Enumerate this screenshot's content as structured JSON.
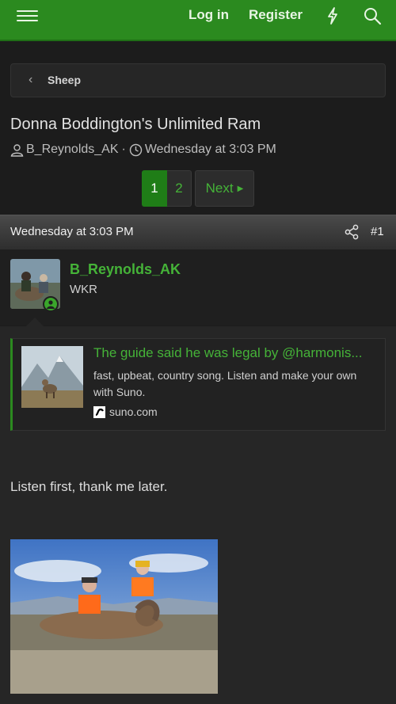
{
  "nav": {
    "login_label": "Log in",
    "register_label": "Register"
  },
  "breadcrumb": {
    "label": "Sheep"
  },
  "thread": {
    "title": "Donna Boddington's Unlimited Ram",
    "author": "B_Reynolds_AK",
    "separator": "·",
    "date": "Wednesday at 3:03 PM"
  },
  "pagination": {
    "pages": [
      "1",
      "2"
    ],
    "current": "1",
    "next_label": "Next"
  },
  "post": {
    "date": "Wednesday at 3:03 PM",
    "number": "#1",
    "username": "B_Reynolds_AK",
    "user_title": "WKR",
    "embed": {
      "title": "The guide said he was legal by @harmonis...",
      "description": "fast, upbeat, country song. Listen and make your own with Suno.",
      "site": "suno.com"
    },
    "text": "Listen first, thank me later."
  },
  "colors": {
    "header_green": "#2b8a1f",
    "link_green": "#45b338",
    "background": "#1c1c1c"
  }
}
